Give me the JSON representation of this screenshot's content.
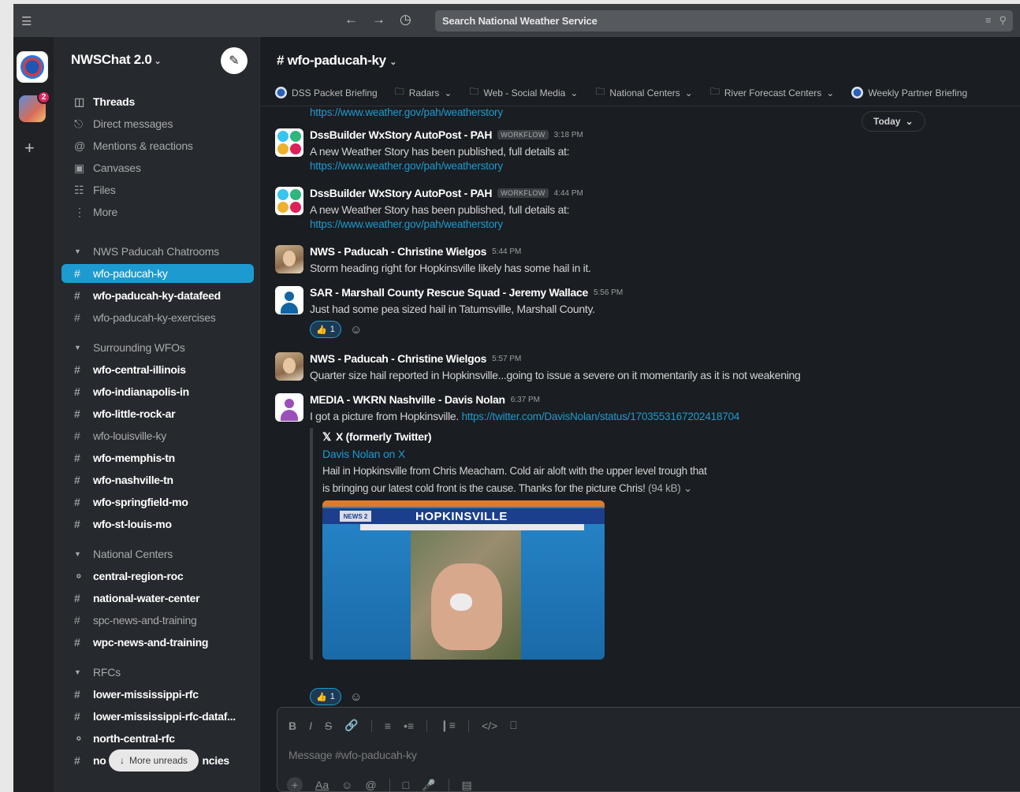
{
  "topbar": {
    "search_placeholder": "Search National Weather Service"
  },
  "workspaces": {
    "badge_count": "2"
  },
  "sidebar": {
    "workspace_name": "NWSChat 2.0",
    "nav": [
      {
        "label": "Threads",
        "icon": "threads-icon",
        "bold": true
      },
      {
        "label": "Direct messages",
        "icon": "dm-icon"
      },
      {
        "label": "Mentions & reactions",
        "icon": "at-icon"
      },
      {
        "label": "Canvases",
        "icon": "canvas-icon"
      },
      {
        "label": "Files",
        "icon": "files-icon"
      },
      {
        "label": "More",
        "icon": "more-icon"
      }
    ],
    "sections": [
      {
        "title": "NWS Paducah Chatrooms",
        "channels": [
          {
            "name": "wfo-paducah-ky",
            "selected": true
          },
          {
            "name": "wfo-paducah-ky-datafeed",
            "bold": true
          },
          {
            "name": "wfo-paducah-ky-exercises"
          }
        ]
      },
      {
        "title": "Surrounding WFOs",
        "channels": [
          {
            "name": "wfo-central-illinois",
            "bold": true
          },
          {
            "name": "wfo-indianapolis-in",
            "bold": true
          },
          {
            "name": "wfo-little-rock-ar",
            "bold": true
          },
          {
            "name": "wfo-louisville-ky"
          },
          {
            "name": "wfo-memphis-tn",
            "bold": true
          },
          {
            "name": "wfo-nashville-tn",
            "bold": true
          },
          {
            "name": "wfo-springfield-mo",
            "bold": true
          },
          {
            "name": "wfo-st-louis-mo",
            "bold": true
          }
        ]
      },
      {
        "title": "National Centers",
        "channels": [
          {
            "name": "central-region-roc",
            "bold": true,
            "locked": true
          },
          {
            "name": "national-water-center",
            "bold": true
          },
          {
            "name": "spc-news-and-training"
          },
          {
            "name": "wpc-news-and-training",
            "bold": true
          }
        ]
      },
      {
        "title": "RFCs",
        "channels": [
          {
            "name": "lower-mississippi-rfc",
            "bold": true
          },
          {
            "name": "lower-mississippi-rfc-dataf...",
            "bold": true
          },
          {
            "name": "north-central-rfc",
            "bold": true,
            "locked": true
          },
          {
            "name": "no",
            "bold": true,
            "suffix": "ncies"
          }
        ]
      }
    ],
    "more_unreads": "More unreads"
  },
  "channel": {
    "title": "# wfo-paducah-ky",
    "bookmarks": [
      {
        "label": "DSS Packet Briefing",
        "icon": "nws-logo-icon"
      },
      {
        "label": "Radars",
        "icon": "folder-icon",
        "dropdown": true
      },
      {
        "label": "Web - Social Media",
        "icon": "folder-icon",
        "dropdown": true
      },
      {
        "label": "National Centers",
        "icon": "folder-icon",
        "dropdown": true
      },
      {
        "label": "River Forecast Centers",
        "icon": "folder-icon",
        "dropdown": true
      },
      {
        "label": "Weekly Partner Briefing",
        "icon": "nws-logo-icon"
      }
    ],
    "date_divider": "Today"
  },
  "messages": {
    "top_link": "https://www.weather.gov/pah/weatherstory",
    "m1": {
      "author": "DssBuilder WxStory AutoPost - PAH",
      "tag": "WORKFLOW",
      "time": "3:18 PM",
      "text": "A new Weather Story has been published, full details at:",
      "link": "https://www.weather.gov/pah/weatherstory"
    },
    "m2": {
      "author": "DssBuilder WxStory AutoPost - PAH",
      "tag": "WORKFLOW",
      "time": "4:44 PM",
      "text": "A new Weather Story has been published, full details at:",
      "link": "https://www.weather.gov/pah/weatherstory"
    },
    "m3": {
      "author": "NWS - Paducah - Christine Wielgos",
      "time": "5:44 PM",
      "text": "Storm heading right for Hopkinsville likely has some hail in it."
    },
    "m4": {
      "author": "SAR - Marshall County Rescue Squad - Jeremy Wallace",
      "time": "5:56 PM",
      "text": "Just had some pea sized hail in Tatumsville, Marshall County.",
      "reaction_count": "1"
    },
    "m5": {
      "author": "NWS - Paducah - Christine Wielgos",
      "time": "5:57 PM",
      "text": "Quarter size hail reported in Hopkinsville...going to issue a severe on it momentarily as it is not weakening"
    },
    "m6": {
      "author": "MEDIA - WKRN Nashville - Davis Nolan",
      "time": "6:37 PM",
      "text": "I got a picture from Hopkinsville.",
      "link": "https://twitter.com/DavisNolan/status/1703553167202418704",
      "unfurl": {
        "source": "X (formerly Twitter)",
        "title": "Davis Nolan on X",
        "desc_line1": "Hail in Hopkinsville from Chris Meacham. Cold air aloft with the upper level trough that",
        "desc_line2": "is bringing our latest cold front is the cause. Thanks for the picture Chris!",
        "size": "(94 kB)",
        "image_heading": "HOPKINSVILLE",
        "image_logo": "NEWS 2"
      },
      "reaction_count": "1"
    }
  },
  "composer": {
    "placeholder": "Message #wfo-paducah-ky"
  },
  "colors": {
    "accent": "#1d9bd1",
    "sidebar_bg": "#26292d",
    "main_bg": "#1a1d21"
  }
}
